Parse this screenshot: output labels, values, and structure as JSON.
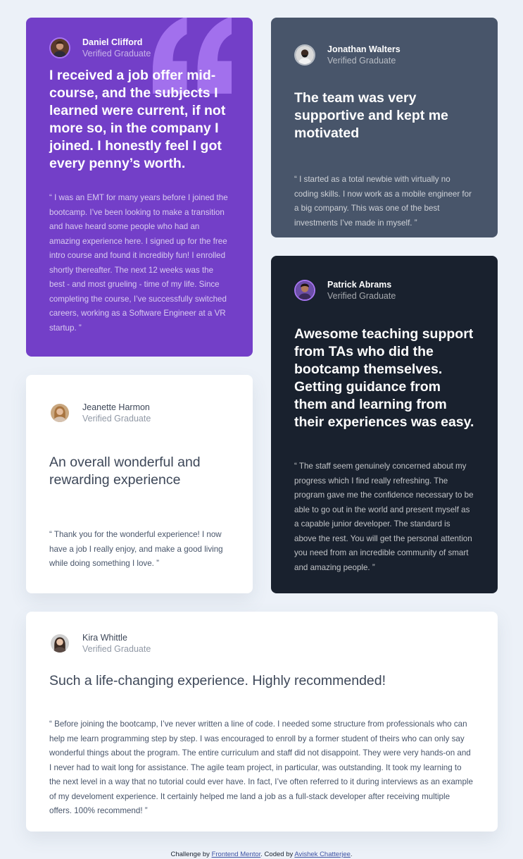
{
  "colors": {
    "page_background": "#ECF1F8",
    "moderate_violet": "#733FC8",
    "grayish_blue": "#48556A",
    "very_dark_blackish_blue": "#19212E",
    "white": "#FFFFFF",
    "light_violet": "#A775F1"
  },
  "testimonials": [
    {
      "name": "Daniel Clifford",
      "role": "Verified Graduate",
      "headline": "I received a job offer mid-course, and the subjects I learned were current, if not more so, in the company I joined. I honestly feel I got every penny’s worth.",
      "body": "“ I was an EMT for many years before I joined the bootcamp. I’ve been looking to make a transition and have heard some people who had an amazing experience here. I signed up for the free intro course and found it incredibly fun! I enrolled shortly thereafter. The next 12 weeks was the best - and most grueling - time of my life. Since completing the course, I’ve successfully switched careers, working as a Software Engineer at a VR startup. ”"
    },
    {
      "name": "Jonathan Walters",
      "role": "Verified Graduate",
      "headline": "The team was very supportive and kept me motivated",
      "body": "“ I started as a total newbie with virtually no coding skills. I now work as a mobile engineer for a big company. This was one of the best investments I’ve made in myself. ”"
    },
    {
      "name": "Patrick Abrams",
      "role": "Verified Graduate",
      "headline": "Awesome teaching support from TAs who did the bootcamp themselves. Getting guidance from them and learning from their experiences was easy.",
      "body": "“ The staff seem genuinely concerned about my progress which I find really refreshing. The program gave me the confidence necessary to be able to go out in the world and present myself as a capable junior developer. The standard is above the rest. You will get the personal attention you need from an incredible community of smart and amazing people. ”"
    },
    {
      "name": "Jeanette Harmon",
      "role": "Verified Graduate",
      "headline": "An overall wonderful and rewarding experience",
      "body": "“ Thank you for the wonderful experience! I now have a job I really enjoy, and make a good living while doing something I love. ”"
    },
    {
      "name": "Kira Whittle",
      "role": "Verified Graduate",
      "headline": "Such a life-changing experience. Highly recommended!",
      "body": "“ Before joining the bootcamp, I’ve never written a line of code. I needed some structure from professionals who can help me learn programming step by step. I was encouraged to enroll by a former student of theirs who can only say wonderful things about the program. The entire curriculum and staff did not disappoint. They were very hands-on and I never had to wait long for assistance. The agile team project, in particular, was outstanding. It took my learning to the next level in a way that no tutorial could ever have. In fact, I’ve often referred to it during interviews as an example of my develoment experience. It certainly helped me land a job as a full-stack developer after receiving multiple offers. 100% recommend! ”"
    }
  ],
  "icons": {
    "background_quote": "quotation-mark-icon"
  },
  "footer": {
    "prefix": "Challenge by ",
    "link1": "Frontend Mentor",
    "middle": ". Coded by ",
    "link2": "Avishek Chatterjee",
    "suffix": "."
  }
}
